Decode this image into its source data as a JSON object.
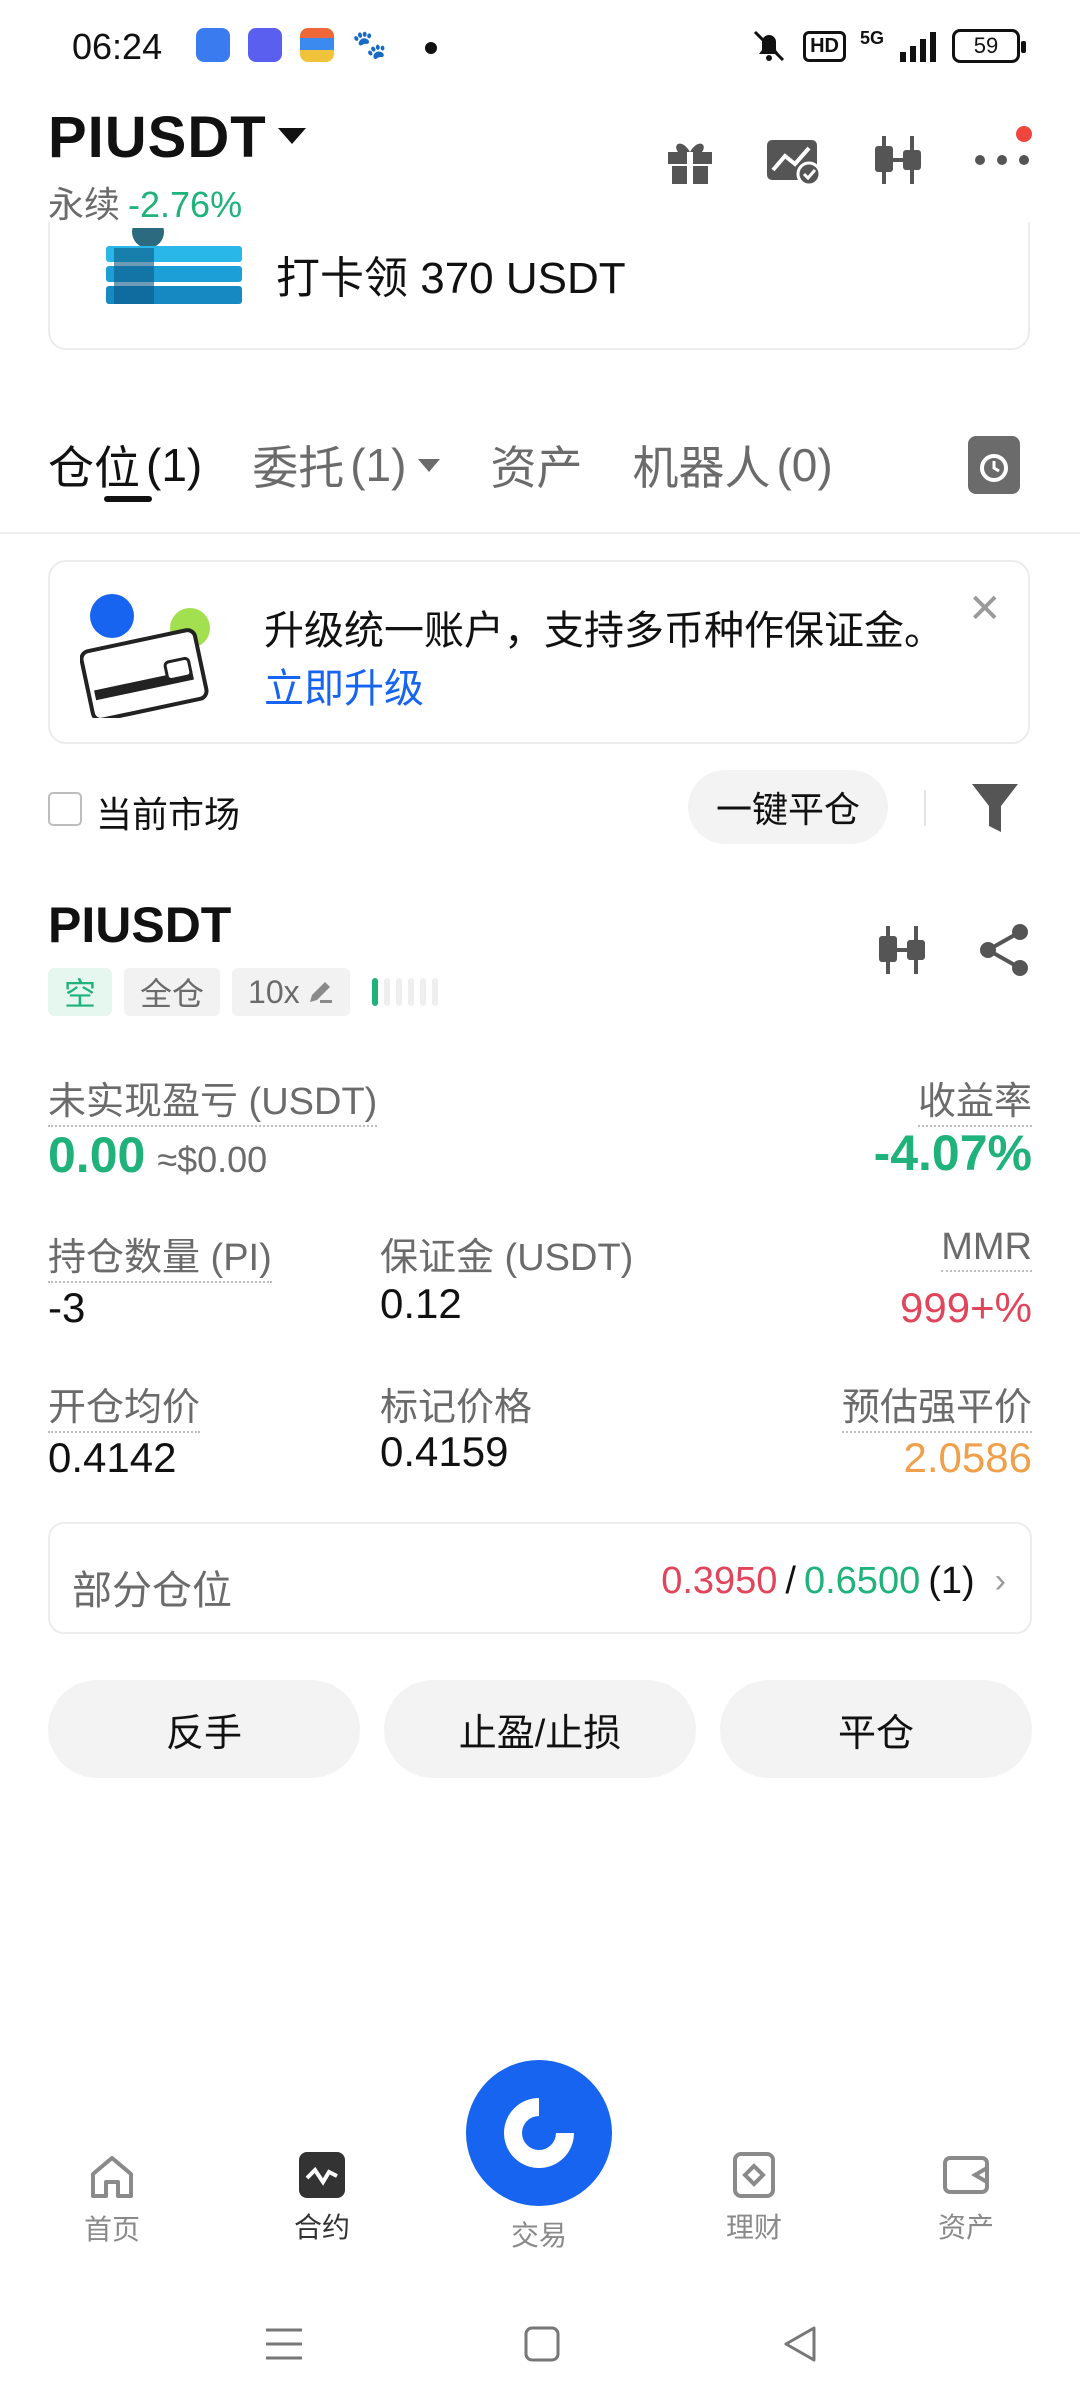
{
  "status_bar": {
    "time": "06:24",
    "hd": "HD",
    "network": "5G",
    "battery": "59"
  },
  "header": {
    "pair": "PIUSDT",
    "contract_type": "永续",
    "change": "-2.76%"
  },
  "banner": {
    "text": "打卡领 370 USDT"
  },
  "tabs": [
    {
      "label": "仓位",
      "count": "(1)"
    },
    {
      "label": "委托",
      "count": "(1)"
    },
    {
      "label": "资产",
      "count": ""
    },
    {
      "label": "机器人",
      "count": "(0)"
    }
  ],
  "upgrade": {
    "text": "升级统一账户，支持多币种作保证金。",
    "link": "立即升级"
  },
  "filter": {
    "current_market": "当前市场",
    "close_all": "一键平仓"
  },
  "position": {
    "symbol": "PIUSDT",
    "side_tag": "空",
    "margin_mode": "全仓",
    "leverage": "10x",
    "unrealized_pnl_label": "未实现盈亏 (USDT)",
    "unrealized_pnl": "0.00",
    "unrealized_pnl_usd": "≈$0.00",
    "roi_label": "收益率",
    "roi": "-4.07%",
    "size_label": "持仓数量 (PI)",
    "size": "-3",
    "margin_label": "保证金 (USDT)",
    "margin": "0.12",
    "mmr_label": "MMR",
    "mmr": "999+%",
    "entry_label": "开仓均价",
    "entry": "0.4142",
    "mark_label": "标记价格",
    "mark": "0.4159",
    "liq_label": "预估强平价",
    "liq": "2.0586"
  },
  "partial": {
    "label": "部分仓位",
    "tp": "0.3950",
    "sep": "/",
    "sl": "0.6500",
    "count": "(1)"
  },
  "actions": {
    "reverse": "反手",
    "tpsl": "止盈/止损",
    "close": "平仓"
  },
  "bottom_nav": {
    "home": "首页",
    "futures": "合约",
    "trade": "交易",
    "finance": "理财",
    "assets": "资产"
  },
  "colors": {
    "green": "#1fb27a",
    "red": "#e0455b",
    "orange": "#f0a04b",
    "blue": "#1664f0"
  }
}
